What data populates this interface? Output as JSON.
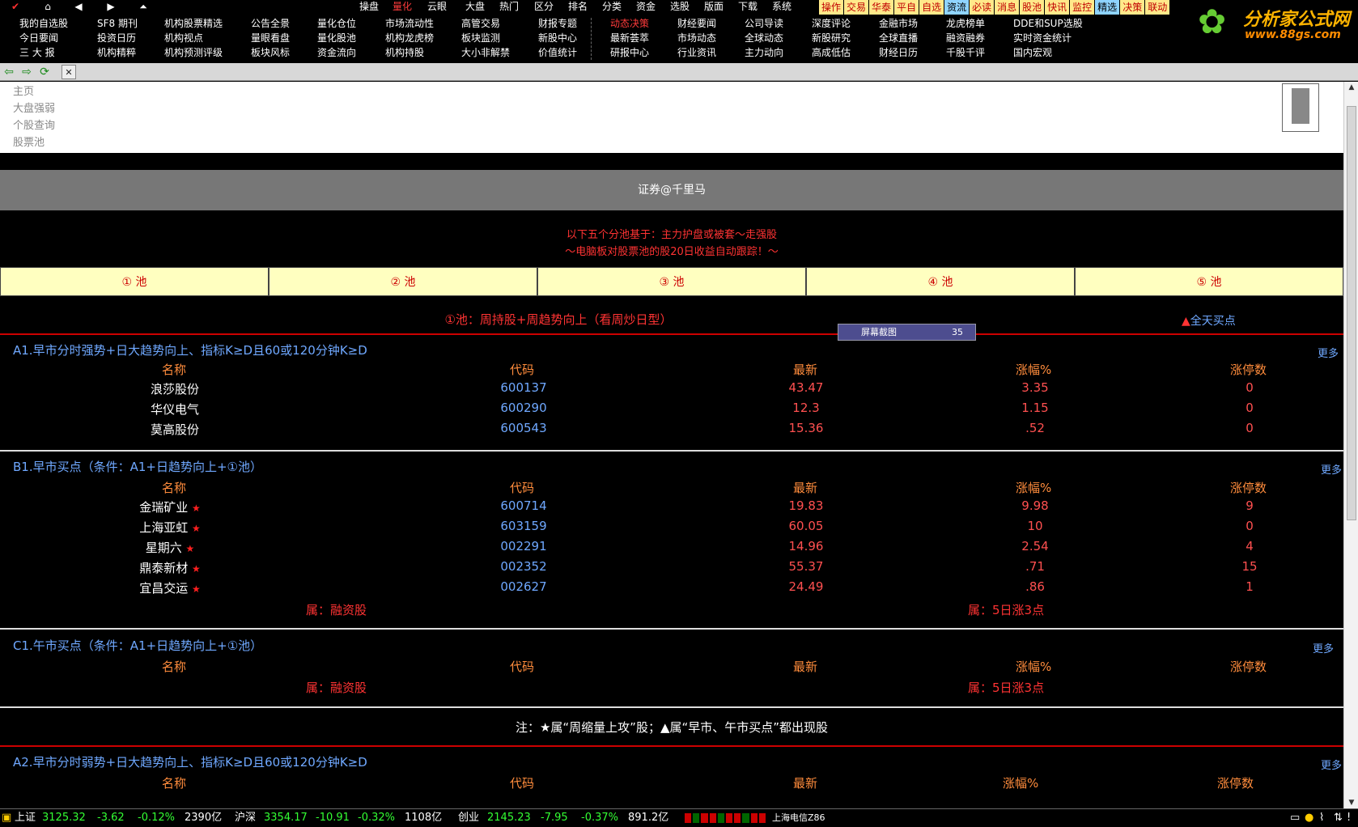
{
  "menu": [
    "操盘",
    "量化",
    "云眼",
    "大盘",
    "热门",
    "区分",
    "排名",
    "分类",
    "资金",
    "选股",
    "版面",
    "下载",
    "系统"
  ],
  "menu_active": "量化",
  "color_tabs": [
    "操作",
    "交易",
    "华泰",
    "平自",
    "自选",
    "资流",
    "必读",
    "消息",
    "股池",
    "快讯",
    "监控",
    "精选",
    "决策",
    "联动"
  ],
  "logo": {
    "title": "分析家公式网",
    "url": "www.88gs.com"
  },
  "links": {
    "c1": [
      "我的自选股",
      "今日要闻",
      "三 大 报"
    ],
    "c2": [
      "SF8 期刊",
      "投资日历",
      "机构精粹"
    ],
    "c3": [
      "机构股票精选",
      "机构视点",
      "机构预测评级"
    ],
    "c4": [
      "公告全景",
      "量眼看盘",
      "板块风标"
    ],
    "c5": [
      "量化仓位",
      "量化股池",
      "资金流向"
    ],
    "c6": [
      "市场流动性",
      "机构龙虎榜",
      "机构持股"
    ],
    "c7": [
      "高管交易",
      "板块监测",
      "大小非解禁"
    ],
    "c8": [
      "财报专题",
      "新股中心",
      "价值统计"
    ],
    "c9": [
      "动态决策",
      "最新荟萃",
      "研报中心"
    ],
    "c10": [
      "财经要闻",
      "市场动态",
      "行业资讯"
    ],
    "c11": [
      "公司导读",
      "全球动态",
      "主力动向"
    ],
    "c12": [
      "深度评论",
      "新股研究",
      "高成低估"
    ],
    "c13": [
      "金融市场",
      "全球直播",
      "财经日历"
    ],
    "c14": [
      "龙虎榜单",
      "融资融券",
      "千股千评"
    ],
    "c15": [
      "DDE和SUP选股",
      "实时资金统计",
      "国内宏观"
    ]
  },
  "nav_panel": [
    "主页",
    "大盘强弱",
    "个股查询",
    "股票池"
  ],
  "banner": "证券@千里马",
  "intro": [
    "以下五个分池基于：主力护盘或被套～走强股",
    "～电脑板对股票池的股20日收益自动跟踪！～"
  ],
  "pools": [
    "① 池",
    "② 池",
    "③ 池",
    "④ 池",
    "⑤ 池"
  ],
  "pool_title": "①池：周持股+周趋势向上（看周炒日型）",
  "pool_right_mark": "▲",
  "pool_right": "全天买点",
  "screenshot_tip": {
    "label": "屏幕截图",
    "num": "35"
  },
  "headers": [
    "名称",
    "代码",
    "最新",
    "涨幅%",
    "涨停数"
  ],
  "more": "更多",
  "sections": {
    "a1": {
      "title": "A1.早市分时强势+日大趋势向上、指标K≥D且60或120分钟K≥D",
      "rows": [
        {
          "name": "浪莎股份",
          "code": "600137",
          "price": "43.47",
          "chg": "3.35",
          "lim": "0"
        },
        {
          "name": "华仪电气",
          "code": "600290",
          "price": "12.3",
          "chg": "1.15",
          "lim": "0"
        },
        {
          "name": "莫高股份",
          "code": "600543",
          "price": "15.36",
          "chg": ".52",
          "lim": "0"
        }
      ]
    },
    "b1": {
      "title": "B1.早市买点（条件：A1+日趋势向上+①池）",
      "rows": [
        {
          "name": "金瑞矿业",
          "code": "600714",
          "price": "19.83",
          "chg": "9.98",
          "lim": "9"
        },
        {
          "name": "上海亚虹",
          "code": "603159",
          "price": "60.05",
          "chg": "10",
          "lim": "0"
        },
        {
          "name": "星期六",
          "code": "002291",
          "price": "14.96",
          "chg": "2.54",
          "lim": "4"
        },
        {
          "name": "鼎泰新材",
          "code": "002352",
          "price": "55.37",
          "chg": ".71",
          "lim": "15"
        },
        {
          "name": "宜昌交运",
          "code": "002627",
          "price": "24.49",
          "chg": ".86",
          "lim": "1"
        }
      ],
      "belong_left": "属：融资股",
      "belong_right": "属：5日涨3点"
    },
    "c1": {
      "title": "C1.午市买点（条件：A1+日趋势向上+①池）",
      "belong_left": "属：融资股",
      "belong_right": "属：5日涨3点"
    },
    "a2": {
      "title": "A2.早市分时弱势+日大趋势向上、指标K≥D且60或120分钟K≥D"
    }
  },
  "note": "注：★属“周缩量上攻”股；▲属“早市、午市买点”都出现股",
  "status": {
    "sh_label": "上证",
    "sh_val": "3125.32",
    "sh_chg": "-3.62",
    "sh_pct": "-0.12%",
    "sh_amt": "2390亿",
    "hs_label": "沪深",
    "hs_val": "3354.17",
    "hs_chg": "-10.91",
    "hs_pct": "-0.32%",
    "hs_amt": "1108亿",
    "cy_label": "创业",
    "cy_val": "2145.23",
    "cy_chg": "-7.95",
    "cy_pct": "-0.37%",
    "cy_amt": "891.2亿",
    "server": "上海电信Z86"
  }
}
